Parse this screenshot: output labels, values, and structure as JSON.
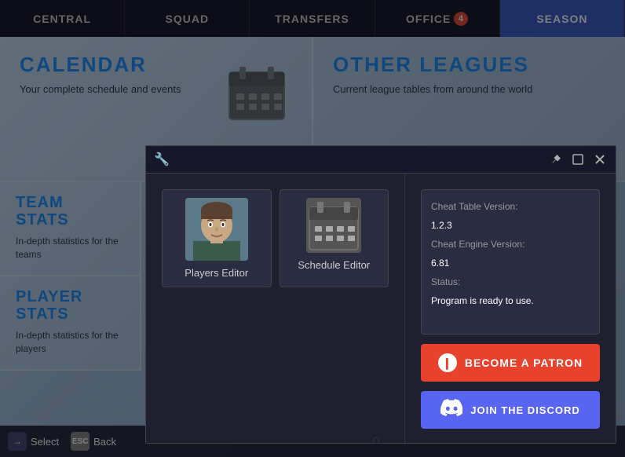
{
  "nav": {
    "items": [
      {
        "id": "central",
        "label": "CENTRAL",
        "active": false
      },
      {
        "id": "squad",
        "label": "SQUAD",
        "active": false
      },
      {
        "id": "transfers",
        "label": "TRANSFERS",
        "active": false
      },
      {
        "id": "office",
        "label": "OFFICE",
        "active": false,
        "badge": "4"
      },
      {
        "id": "season",
        "label": "SEASON",
        "active": true
      }
    ]
  },
  "cards": [
    {
      "id": "calendar",
      "title": "CALENDAR",
      "description": "Your complete schedule and events",
      "icon": "📅"
    },
    {
      "id": "other-leagues",
      "title": "OTHER LEAGUES",
      "description": "Current league tables from around the world",
      "icon": ""
    }
  ],
  "stats": [
    {
      "id": "team-stats",
      "title": "TEAM\nSTATS",
      "description": "In-depth statistics for the teams"
    },
    {
      "id": "player-stats",
      "title": "PLAYER STATS",
      "description": "In-depth statistics for the players"
    }
  ],
  "modal": {
    "wrench_icon": "🔧",
    "pin_icon": "📌",
    "maximize_icon": "⬜",
    "close_icon": "✕",
    "editors": [
      {
        "id": "players-editor",
        "label": "Players Editor",
        "type": "avatar"
      },
      {
        "id": "schedule-editor",
        "label": "Schedule Editor",
        "type": "calendar"
      }
    ],
    "info": {
      "cheat_table_label": "Cheat Table Version:",
      "cheat_table_value": "1.2.3",
      "cheat_engine_label": "Cheat Engine Version:",
      "cheat_engine_value": "6.81",
      "status_label": "Status:",
      "status_value": "Program is ready to use."
    },
    "patron_btn_label": "BECOME A PATRON",
    "discord_btn_label": "JOIN THE DISCORD"
  },
  "bottom_bar": {
    "select_icon": "→",
    "select_label": "Select",
    "back_icon": "ESC",
    "back_label": "Back"
  }
}
